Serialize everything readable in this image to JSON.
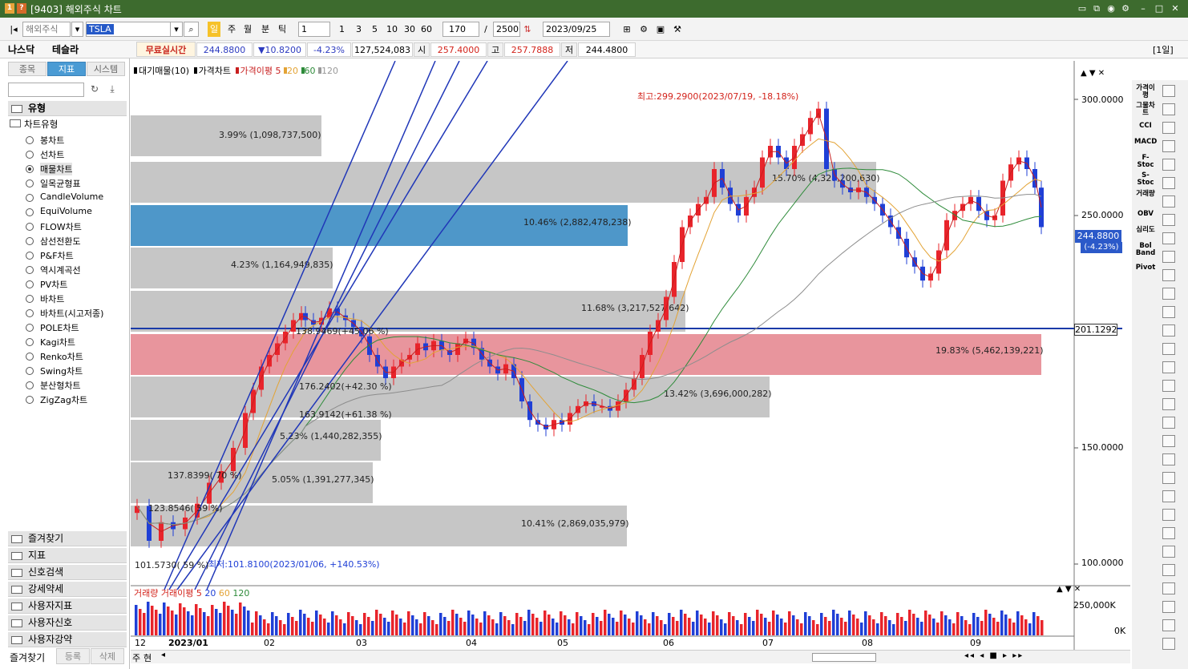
{
  "window": {
    "title": "[9403] 해외주식 차트",
    "icon1": "1",
    "icon2": "?"
  },
  "toolbar": {
    "market": "해외주식",
    "symbol": "TSLA",
    "periods": [
      "일",
      "주",
      "월",
      "분",
      "틱"
    ],
    "interval": "1",
    "minutes": [
      "1",
      "3",
      "5",
      "10",
      "30",
      "60"
    ],
    "count": "170",
    "total": "2500",
    "date": "2023/09/25"
  },
  "quote": {
    "exchange": "나스닥",
    "name": "테슬라",
    "realtime": "무료실시간",
    "price": "244.8800",
    "change": "▼10.8200",
    "rate": "-4.23%",
    "volume": "127,524,083",
    "open_label": "시",
    "open": "257.4000",
    "high_label": "고",
    "high": "257.7888",
    "low_label": "저",
    "low": "244.4800",
    "period_tag": "[1일]"
  },
  "leftpanel": {
    "tabs": [
      "종목",
      "지표",
      "시스템"
    ],
    "type_header": "유형",
    "tree_header": "차트유형",
    "items": [
      "봉차트",
      "선차트",
      "매물차트",
      "일목균형표",
      "CandleVolume",
      "EquiVolume",
      "FLOW차트",
      "삼선전환도",
      "P&F차트",
      "역시계곡선",
      "PV차트",
      "바차트",
      "바차트(시고저종)",
      "POLE차트",
      "Kagi차트",
      "Renko차트",
      "Swing차트",
      "분산형차트",
      "ZigZag차트"
    ],
    "selected_index": 2,
    "sections": [
      "즐겨찾기",
      "지표",
      "신호검색",
      "강세약세",
      "사용자지표",
      "사용자신호",
      "사용자강약"
    ],
    "bottom": [
      "즐겨찾기",
      "등록",
      "삭제"
    ]
  },
  "chart": {
    "legend": [
      "대기매물(10)",
      "가격차트",
      "가격이평",
      "5",
      "20",
      "60",
      "120"
    ],
    "high_label": "최고:299.2900(2023/07/19, -18.18%)",
    "low_label": "최저:101.8100(2023/01/06, +140.53%)",
    "y_ticks": [
      "300.0000",
      "250.0000",
      "150.0000",
      "100.0000"
    ],
    "price_box": "244.8800",
    "price_rate": "(-4.23%)",
    "line_value": "201.1292",
    "volume_profile": [
      {
        "label": "3.99% (1,098,737,500)"
      },
      {
        "label": "15.70% (4,327,200,630)"
      },
      {
        "label": "10.46% (2,882,478,238)"
      },
      {
        "label": "4.23% (1,164,949,835)"
      },
      {
        "label": "11.68% (3,217,527,642)"
      },
      {
        "label": "19.83% (5,462,139,221)"
      },
      {
        "label": "13.42% (3,696,000,282)"
      },
      {
        "label": "5.23% (1,440,282,355)"
      },
      {
        "label": "5.05% (1,391,277,345)"
      },
      {
        "label": "10.41% (2,869,035,979)"
      }
    ],
    "fan_labels": [
      "138.9469(+45.06 %)",
      "176.2402(+42.30 %)",
      "163.9142(+61.38 %)",
      "137.8399( 70 %)",
      "123.8546( 59 %)",
      "101.5730( 59 %)"
    ],
    "volume_legend": [
      "거래량",
      "거래이평",
      "5",
      "20",
      "60",
      "120"
    ],
    "volume_ticks": [
      "250,000K",
      "0K"
    ],
    "x_labels": [
      "12",
      "2023/01",
      "02",
      "03",
      "04",
      "05",
      "06",
      "07",
      "08",
      "09"
    ],
    "bottom_btns": [
      "주",
      "현"
    ]
  },
  "rightbar": {
    "labels": [
      "가격이평",
      "그물차트",
      "CCI",
      "MACD",
      "F-Stoc",
      "S-Stoc",
      "거래량",
      "OBV",
      "심리도",
      "Bol Band",
      "Pivot"
    ]
  },
  "colors": {
    "up": "#e8242b",
    "down": "#1f3fd6",
    "ma5": "#c81e1e",
    "ma20": "#e3a335",
    "ma60": "#2e8b3a",
    "ma120": "#8d8d8d",
    "bar_gray": "#c6c6c6",
    "bar_blue": "#4e97c9",
    "bar_pink": "#e8959d",
    "fan": "#2037b8"
  }
}
